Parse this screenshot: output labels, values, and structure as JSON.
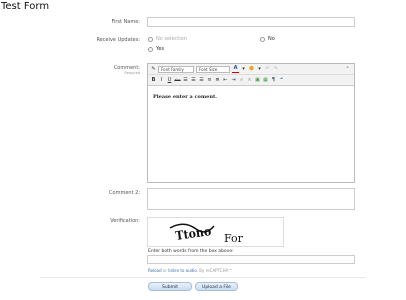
{
  "page": {
    "title": "Test Form"
  },
  "fields": {
    "first_name_label": "First Name:",
    "updates_label": "Receive Updates:",
    "updates_options": [
      {
        "label": "No selection"
      },
      {
        "label": "No"
      },
      {
        "label": "Yes"
      }
    ],
    "comment_label": "Comment:",
    "comment_required": "Required",
    "comment_value": "Please enter a coment.",
    "comment2_label": "Comment 2:",
    "verification_label": "Verification:"
  },
  "editor": {
    "font_family": "Font Family",
    "font_size": "Font Size"
  },
  "captcha": {
    "words": [
      "Ttono",
      "For"
    ],
    "instructions": "Enter both words from the box above:",
    "reload": "Reload",
    "or": " or ",
    "listen": "listen to audio",
    "by": ". By reCAPTCHA™"
  },
  "buttons": {
    "submit": "Submit",
    "upload": "Upload a File"
  }
}
